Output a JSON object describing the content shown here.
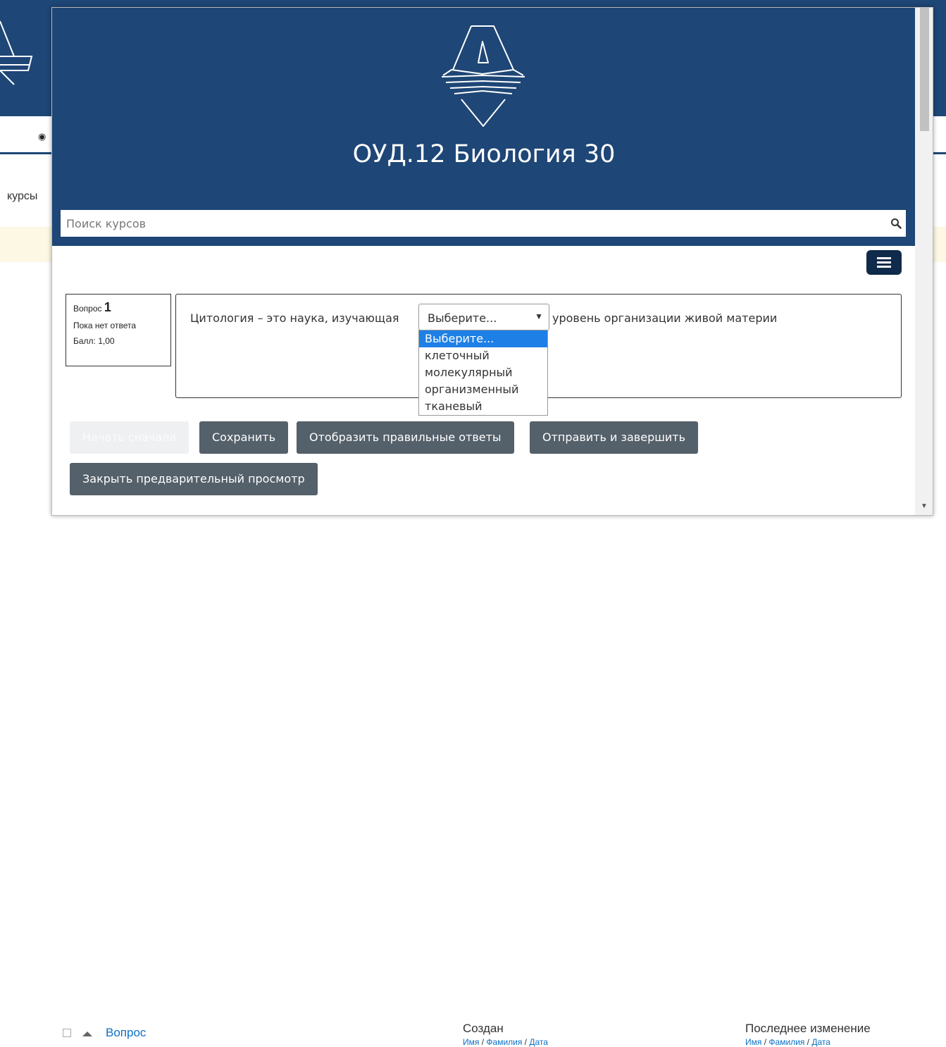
{
  "background": {
    "nav_label": "курсы",
    "table": {
      "question_col": "Вопрос",
      "created_col": "Создан",
      "modified_col": "Последнее изменение",
      "name_links": [
        "Имя",
        "Фамилия",
        "Дата"
      ]
    }
  },
  "popup": {
    "course_title": "ОУД.12 Биология 30",
    "search": {
      "placeholder": "Поиск курсов",
      "icon": "search-icon"
    },
    "menu_icon": "hamburger-icon",
    "question_info": {
      "label": "Вопрос",
      "number": "1",
      "status": "Пока нет ответа",
      "score": "Балл: 1,00"
    },
    "question": {
      "text_before": "Цитология – это наука, изучающая",
      "select_value": "Выберите...",
      "text_after": "уровень организации живой материи",
      "options": [
        "Выберите...",
        "клеточный",
        "молекулярный",
        "организменный",
        "тканевый"
      ],
      "selected_index": 0
    },
    "buttons": {
      "restart": "Начать сначала",
      "save": "Сохранить",
      "show_answers": "Отобразить правильные ответы",
      "submit": "Отправить и завершить",
      "close_preview": "Закрыть предварительный просмотр"
    }
  },
  "colors": {
    "header_bg": "#1e4676",
    "button_bg": "#54606a",
    "selected_option": "#1e80e6"
  }
}
